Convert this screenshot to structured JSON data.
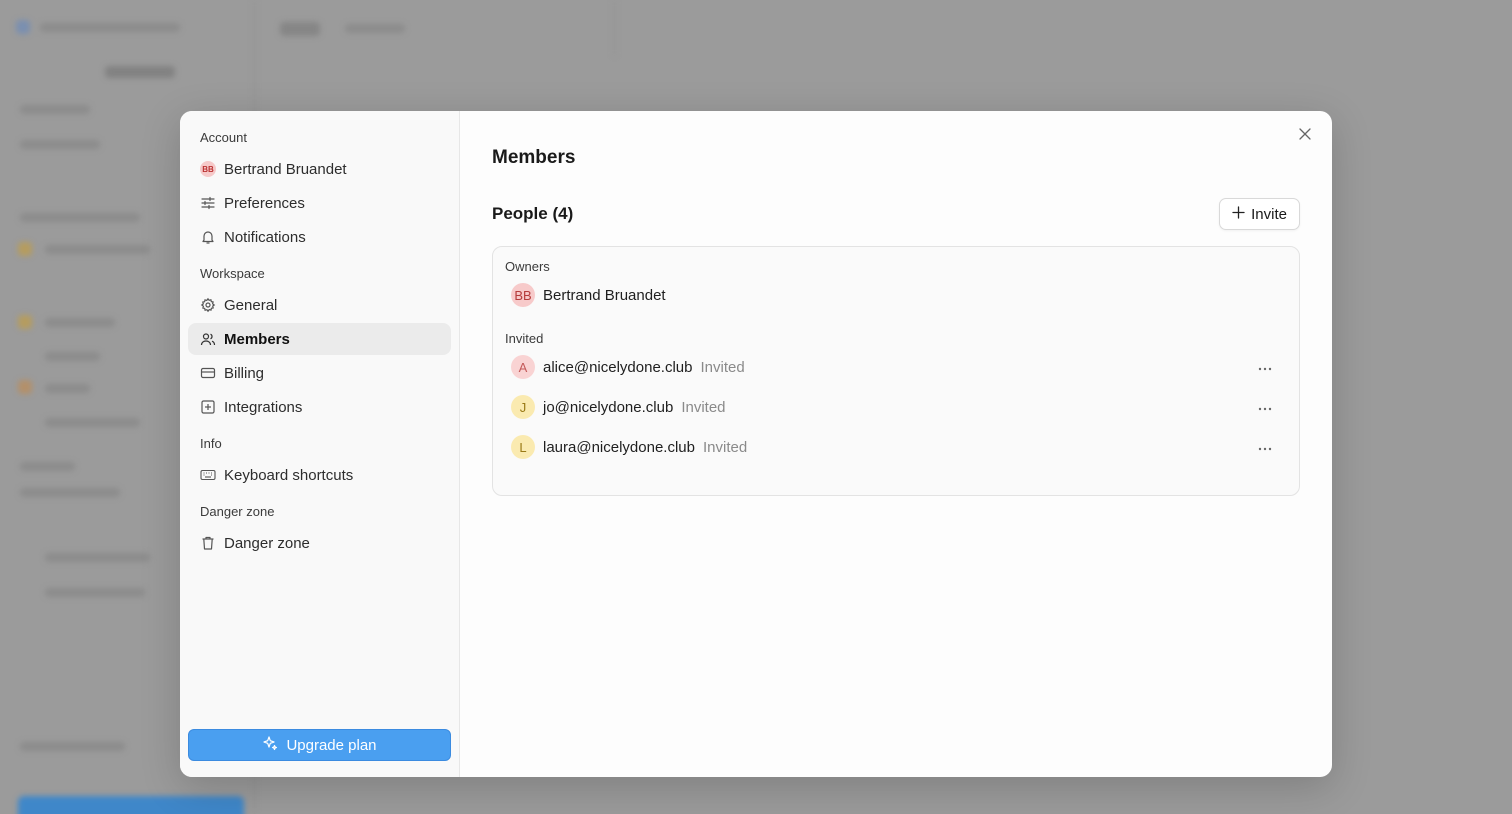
{
  "sidebar": {
    "sections": {
      "account": "Account",
      "workspace": "Workspace",
      "info": "Info",
      "danger": "Danger zone"
    },
    "items": {
      "profile": {
        "label": "Bertrand Bruandet",
        "initials": "BB"
      },
      "preferences": {
        "label": "Preferences"
      },
      "notifications": {
        "label": "Notifications"
      },
      "general": {
        "label": "General"
      },
      "members": {
        "label": "Members"
      },
      "billing": {
        "label": "Billing"
      },
      "integrations": {
        "label": "Integrations"
      },
      "shortcuts": {
        "label": "Keyboard shortcuts"
      },
      "danger_zone": {
        "label": "Danger zone"
      }
    },
    "upgrade_label": "Upgrade plan"
  },
  "main": {
    "title": "Members",
    "people_title": "People (4)",
    "invite_label": "Invite",
    "owners_label": "Owners",
    "invited_label": "Invited",
    "owners": [
      {
        "initials": "BB",
        "name": "Bertrand Bruandet"
      }
    ],
    "invited": [
      {
        "initials": "A",
        "email": "alice@nicelydone.club",
        "status": "Invited"
      },
      {
        "initials": "J",
        "email": "jo@nicelydone.club",
        "status": "Invited"
      },
      {
        "initials": "L",
        "email": "laura@nicelydone.club",
        "status": "Invited"
      }
    ]
  },
  "colors": {
    "accent": "#4a9ff0",
    "overlay": "#9b9b9b",
    "active_item": "#ebebeb"
  },
  "icons": {
    "close": "close-icon",
    "invite": "plus-icon",
    "more": "more-horizontal-icon",
    "upgrade": "sparkles-icon"
  }
}
